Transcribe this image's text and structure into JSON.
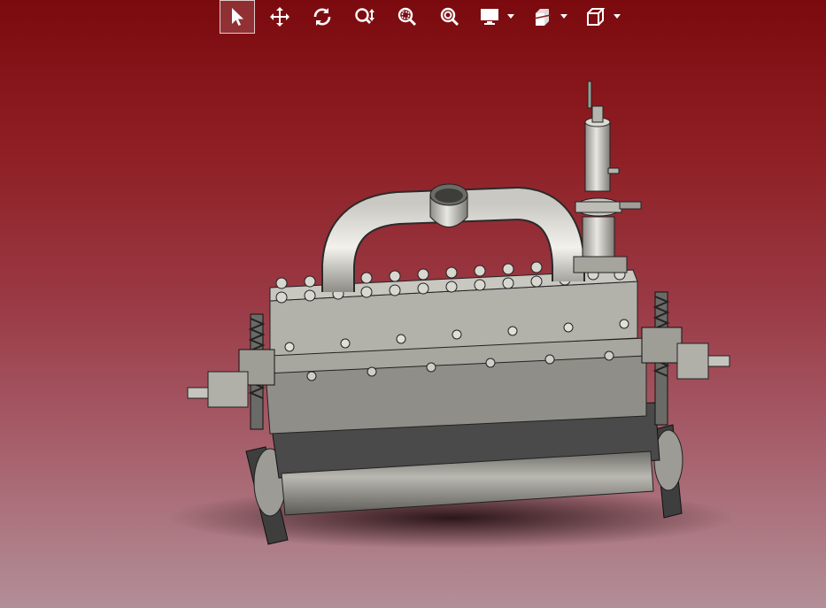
{
  "app": {
    "background_top": "#7b0a0e",
    "background_bottom": "#b28f98"
  },
  "toolbar": {
    "items": [
      {
        "name": "select-tool",
        "icon": "cursor-arrow-icon",
        "active": true,
        "dropdown": false
      },
      {
        "name": "pan-tool",
        "icon": "move-arrows-icon",
        "active": false,
        "dropdown": false
      },
      {
        "name": "rotate-tool",
        "icon": "rotate-icon",
        "active": false,
        "dropdown": false
      },
      {
        "name": "zoom-tool",
        "icon": "zoom-updown-icon",
        "active": false,
        "dropdown": false
      },
      {
        "name": "zoom-window-tool",
        "icon": "zoom-window-icon",
        "active": false,
        "dropdown": false
      },
      {
        "name": "zoom-fit-tool",
        "icon": "zoom-fit-icon",
        "active": false,
        "dropdown": false
      },
      {
        "name": "display-mode",
        "icon": "monitor-icon",
        "active": false,
        "dropdown": true
      },
      {
        "name": "section-view",
        "icon": "section-cube-icon",
        "active": false,
        "dropdown": true
      },
      {
        "name": "view-orientation",
        "icon": "cube-icon",
        "active": false,
        "dropdown": true
      }
    ]
  },
  "model": {
    "description_icon": "assembly-model-icon",
    "metal_color": "#a8a7a0",
    "dark_color": "#4a4a4a"
  }
}
